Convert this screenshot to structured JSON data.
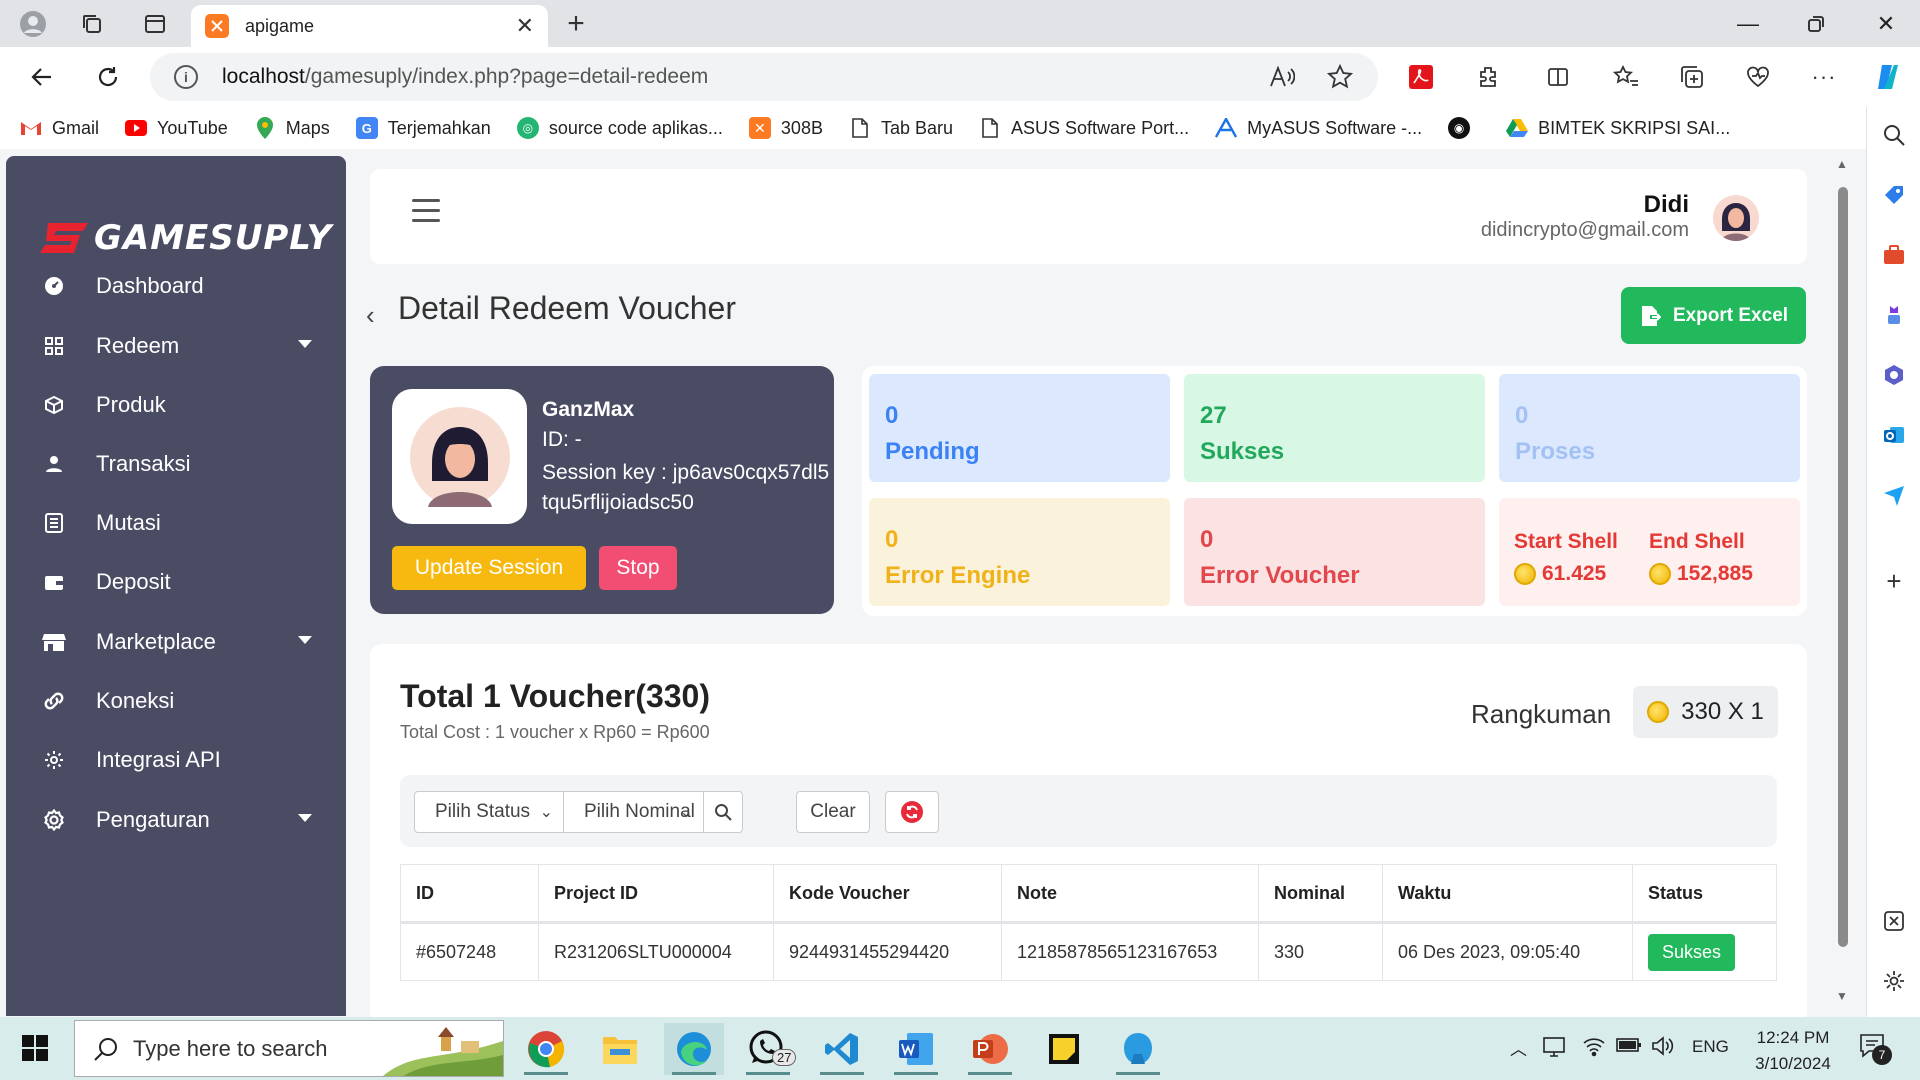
{
  "browser": {
    "tab_title": "apigame",
    "url_host": "localhost",
    "url_path": "/gamesuply/index.php?page=detail-redeem",
    "bookmarks": [
      {
        "label": "Gmail",
        "icon": "gmail-icon"
      },
      {
        "label": "YouTube",
        "icon": "youtube-icon"
      },
      {
        "label": "Maps",
        "icon": "maps-icon"
      },
      {
        "label": "Terjemahkan",
        "icon": "translate-icon"
      },
      {
        "label": "source code aplikas...",
        "icon": "globe-icon"
      },
      {
        "label": "308B",
        "icon": "xampp-icon"
      },
      {
        "label": "Tab Baru",
        "icon": "page-icon"
      },
      {
        "label": "ASUS Software Port...",
        "icon": "page-icon"
      },
      {
        "label": "MyASUS Software -...",
        "icon": "myasus-icon"
      },
      {
        "label": "",
        "icon": "github-icon"
      },
      {
        "label": "BIMTEK SKRIPSI SAI...",
        "icon": "drive-icon"
      }
    ]
  },
  "app": {
    "brand": "GAMESUPLY",
    "colors": {
      "sidebar": "#4a4c64",
      "success": "#22b95c",
      "warning": "#f7b90f",
      "danger": "#f24e73"
    },
    "menu": [
      {
        "label": "Dashboard",
        "icon": "dashboard-icon",
        "has_caret": false
      },
      {
        "label": "Redeem",
        "icon": "grid-icon",
        "has_caret": true
      },
      {
        "label": "Produk",
        "icon": "box-icon",
        "has_caret": false
      },
      {
        "label": "Transaksi",
        "icon": "user-icon",
        "has_caret": false
      },
      {
        "label": "Mutasi",
        "icon": "list-icon",
        "has_caret": false
      },
      {
        "label": "Deposit",
        "icon": "wallet-icon",
        "has_caret": false
      },
      {
        "label": "Marketplace",
        "icon": "store-icon",
        "has_caret": true
      },
      {
        "label": "Koneksi",
        "icon": "link-icon",
        "has_caret": false
      },
      {
        "label": "Integrasi API",
        "icon": "api-gear-icon",
        "has_caret": false
      },
      {
        "label": "Pengaturan",
        "icon": "settings-icon",
        "has_caret": true
      }
    ],
    "user": {
      "name": "Didi",
      "email": "didincrypto@gmail.com"
    }
  },
  "page": {
    "title": "Detail Redeem Voucher",
    "export_label": "Export Excel",
    "profile": {
      "name": "GanzMax",
      "id_line": "ID: -",
      "session_key": "Session key : jp6avs0cqx57dl5tqu5rflijoiadsc50",
      "update_label": "Update Session",
      "stop_label": "Stop"
    },
    "stats": {
      "pending": {
        "value": "0",
        "label": "Pending"
      },
      "sukses": {
        "value": "27",
        "label": "Sukses"
      },
      "proses": {
        "value": "0",
        "label": "Proses"
      },
      "error_engine": {
        "value": "0",
        "label": "Error Engine"
      },
      "error_voucher": {
        "value": "0",
        "label": "Error Voucher"
      },
      "start_shell": {
        "label": "Start Shell",
        "value": "61.425"
      },
      "end_shell": {
        "label": "End Shell",
        "value": "152,885"
      }
    },
    "summary": {
      "title": "Total 1 Voucher(330)",
      "subtitle": "Total Cost : 1 voucher x Rp60 = Rp600",
      "rangkuman_label": "Rangkuman",
      "rangkuman_value": "330 X 1"
    },
    "filters": {
      "status_placeholder": "Pilih Status",
      "nominal_placeholder": "Pilih Nominal",
      "clear_label": "Clear"
    },
    "table": {
      "columns": [
        "ID",
        "Project ID",
        "Kode Voucher",
        "Note",
        "Nominal",
        "Waktu",
        "Status"
      ],
      "rows": [
        [
          "#6507248",
          "R231206SLTU000004",
          "9244931455294420",
          "12185878565123167653",
          "330",
          "06 Des 2023, 09:05:40",
          "Sukses"
        ]
      ]
    }
  },
  "taskbar": {
    "search_placeholder": "Type here to search",
    "whatsapp_badge": "27",
    "lang": "ENG",
    "time": "12:24 PM",
    "date": "3/10/2024",
    "notif_count": "7"
  }
}
